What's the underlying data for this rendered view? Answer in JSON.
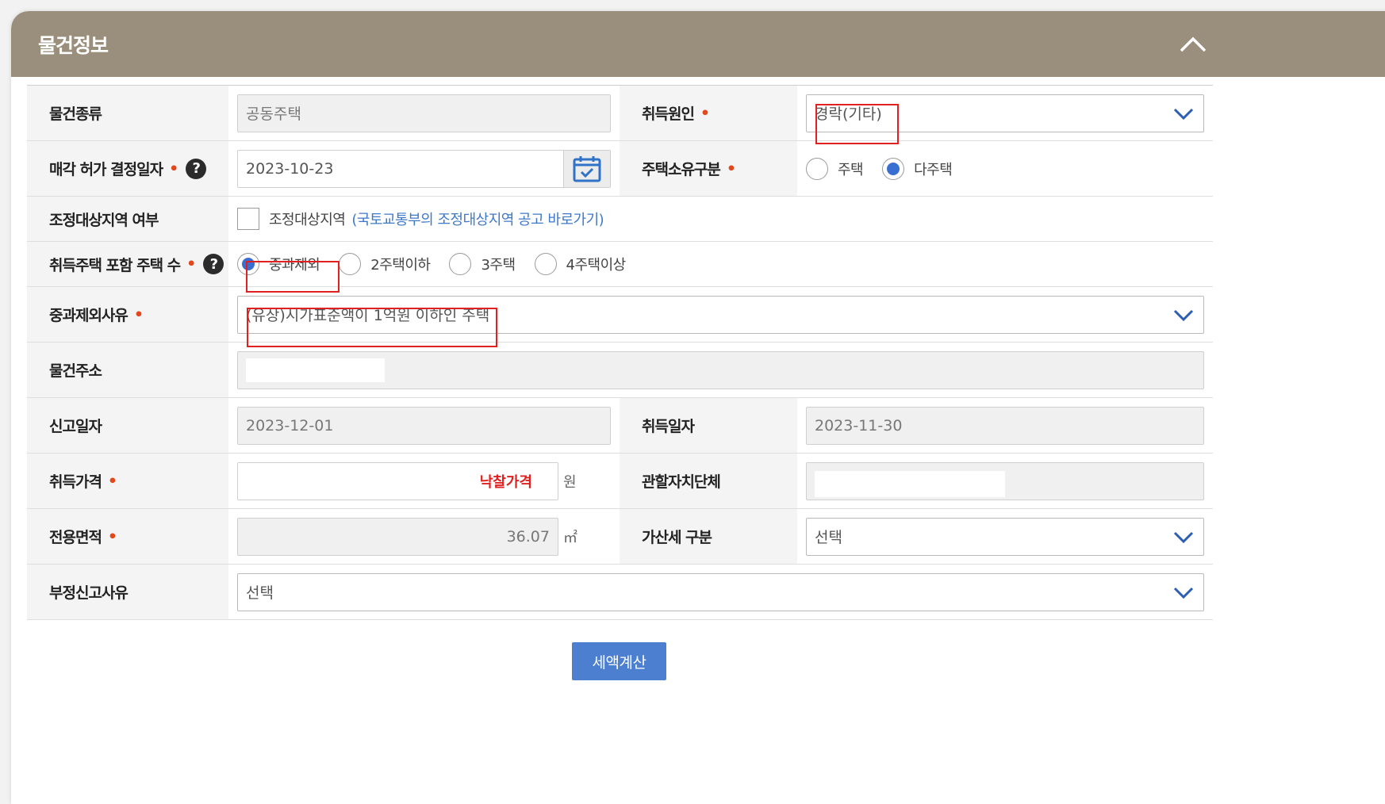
{
  "panel": {
    "title": "물건정보"
  },
  "fields": {
    "property_type": {
      "label": "물건종류",
      "value": "공동주택"
    },
    "acquisition_cause": {
      "label": "취득원인",
      "value": "경락(기타)"
    },
    "sale_permit_date": {
      "label": "매각 허가 결정일자",
      "value": "2023-10-23"
    },
    "house_ownership": {
      "label": "주택소유구분",
      "options": [
        "주택",
        "다주택"
      ],
      "selected": "다주택"
    },
    "adjusted_area": {
      "label": "조정대상지역 여부",
      "checkbox_label": "조정대상지역",
      "link": "(국토교통부의 조정대상지역 공고 바로가기)"
    },
    "house_count": {
      "label": "취득주택 포함 주택 수",
      "options": [
        "중과제외",
        "2주택이하",
        "3주택",
        "4주택이상"
      ],
      "selected": "중과제외"
    },
    "exclusion_reason": {
      "label": "중과제외사유",
      "value": "(유상)시가표준액이 1억원 이하인 주택"
    },
    "address": {
      "label": "물건주소",
      "value": ""
    },
    "report_date": {
      "label": "신고일자",
      "value": "2023-12-01"
    },
    "acquisition_date": {
      "label": "취득일자",
      "value": "2023-11-30"
    },
    "acquisition_price": {
      "label": "취득가격",
      "value": "낙찰가격",
      "unit": "원"
    },
    "jurisdiction": {
      "label": "관할자치단체",
      "value": ""
    },
    "exclusive_area": {
      "label": "전용면적",
      "value": "36.07",
      "unit": "㎡"
    },
    "penalty_type": {
      "label": "가산세 구분",
      "value": "선택"
    },
    "improper_reason": {
      "label": "부정신고사유",
      "value": "선택"
    }
  },
  "required_mark": "•",
  "help_mark": "?",
  "actions": {
    "calculate": "세액계산"
  },
  "colors": {
    "header": "#9a8f7c",
    "accent": "#3a6fd2",
    "required": "#e2481c",
    "highlight": "#e12020",
    "button": "#4c7fd0"
  }
}
